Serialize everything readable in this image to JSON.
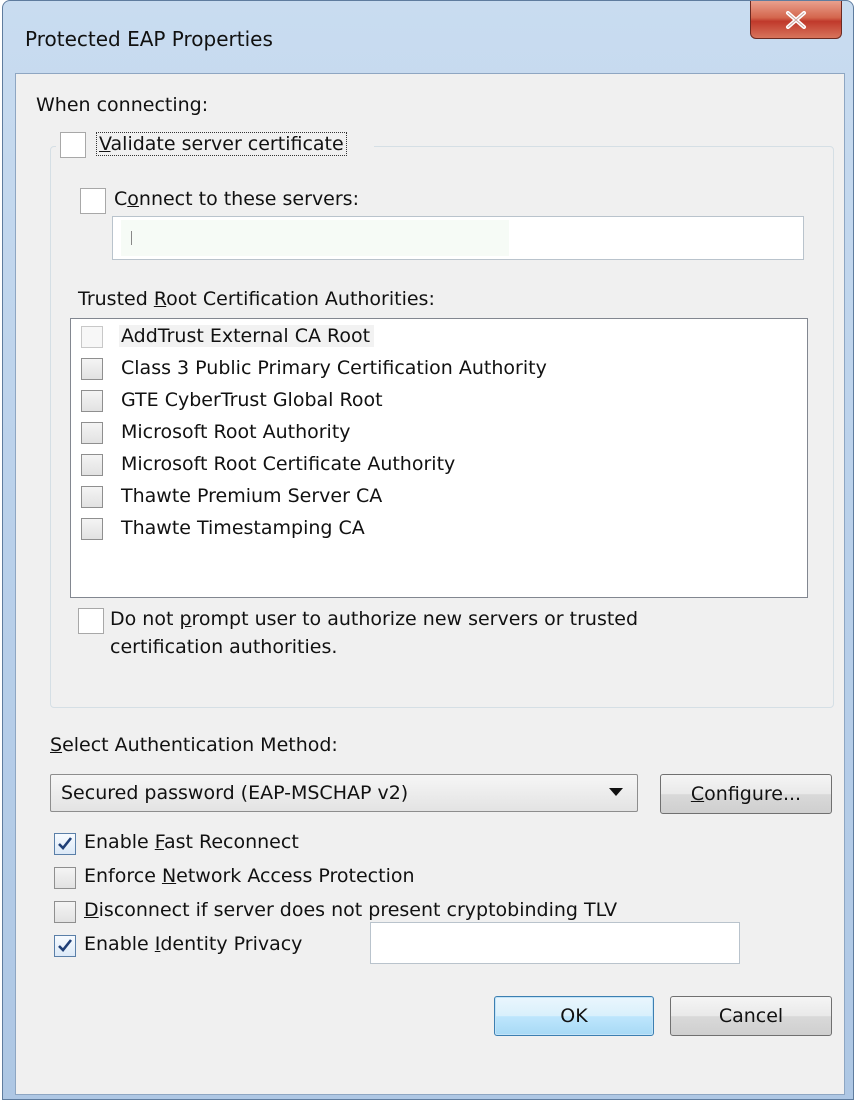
{
  "window": {
    "title": "Protected EAP Properties"
  },
  "connecting": {
    "heading": "When connecting:",
    "validate_cert": {
      "prefix": "",
      "key": "V",
      "rest": "alidate server certificate",
      "checked": false
    },
    "connect_servers": {
      "prefix": "C",
      "key": "o",
      "rest": "nnect to these servers:",
      "checked": false,
      "value": ""
    },
    "trusted_root_label": {
      "prefix": "Trusted ",
      "key": "R",
      "rest": "oot Certification Authorities:"
    },
    "authorities": [
      {
        "label": "AddTrust External CA Root",
        "checked": false
      },
      {
        "label": "Class 3 Public Primary Certification Authority",
        "checked": false
      },
      {
        "label": "GTE CyberTrust Global Root",
        "checked": false
      },
      {
        "label": "Microsoft Root Authority",
        "checked": false
      },
      {
        "label": "Microsoft Root Certificate Authority",
        "checked": false
      },
      {
        "label": "Thawte Premium Server CA",
        "checked": false
      },
      {
        "label": "Thawte Timestamping CA",
        "checked": false
      }
    ],
    "do_not_prompt": {
      "line1_prefix": "Do not ",
      "line1_key": "p",
      "line1_rest": "rompt user to authorize new servers or trusted",
      "line2": "certification authorities.",
      "checked": false
    }
  },
  "auth": {
    "label": {
      "key": "S",
      "rest": "elect Authentication Method:"
    },
    "selected_method": "Secured password (EAP-MSCHAP v2)",
    "configure_button": {
      "key": "C",
      "rest": "onfigure..."
    }
  },
  "options": [
    {
      "prefix": "Enable ",
      "key": "F",
      "rest": "ast Reconnect",
      "checked": true
    },
    {
      "prefix": "Enforce ",
      "key": "N",
      "rest": "etwork Access Protection",
      "checked": false
    },
    {
      "prefix": "",
      "key": "D",
      "rest": "isconnect if server does not present cryptobinding TLV",
      "checked": false
    },
    {
      "prefix": "Enable ",
      "key": "I",
      "rest": "dentity Privacy",
      "checked": true
    }
  ],
  "identity_value": "",
  "buttons": {
    "ok": "OK",
    "cancel": "Cancel"
  },
  "colors": {
    "checkmark": "#1f3f77",
    "title_bar": "#b9d0ea",
    "close_button": "#c0392b",
    "dialog_face": "#f0f0f0"
  }
}
